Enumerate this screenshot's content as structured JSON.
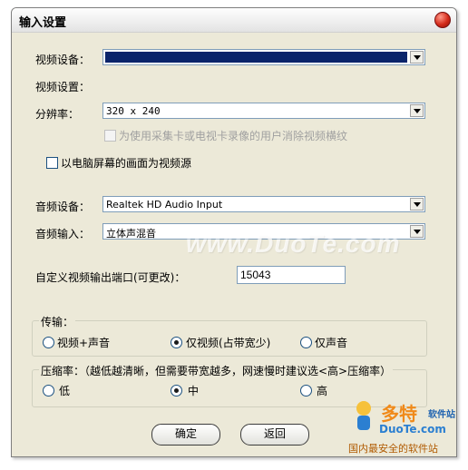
{
  "window": {
    "title": "输入设置"
  },
  "video": {
    "device_label": "视频设备：",
    "settings_label": "视频设置：",
    "resolution_label": "分辨率：",
    "resolution_value": "320 x 240",
    "deinterlace_label": "为使用采集卡或电视卡录像的用户消除视频横纹",
    "screen_source_label": "以电脑屏幕的画面为视频源"
  },
  "audio": {
    "device_label": "音频设备：",
    "device_value": "Realtek HD Audio Input",
    "input_label": "音频输入：",
    "input_value": "立体声混音"
  },
  "port": {
    "label": "自定义视频输出端口(可更改)：",
    "value": "15043"
  },
  "transmission": {
    "legend": "传输：",
    "options": [
      {
        "label": "视频+声音",
        "checked": false
      },
      {
        "label": "仅视频(占带宽少)",
        "checked": true
      },
      {
        "label": "仅声音",
        "checked": false
      }
    ]
  },
  "compression": {
    "legend": "压缩率：（越低越清晰，但需要带宽越多，网速慢时建议选<高>压缩率）",
    "options": [
      {
        "label": "低",
        "checked": false
      },
      {
        "label": "中",
        "checked": true
      },
      {
        "label": "高",
        "checked": false
      }
    ]
  },
  "buttons": {
    "ok": "确定",
    "back": "返回"
  },
  "watermark": {
    "text": "www.DuoTe.com"
  },
  "corner_logo": {
    "cn": "多特",
    "small": "软件站",
    "en": "DuoTe.com",
    "slogan": "国内最安全的软件站"
  },
  "colors": {
    "highlight": "#0a246a",
    "window_bg": "#ece9d8",
    "close_red": "#d42a1a"
  }
}
